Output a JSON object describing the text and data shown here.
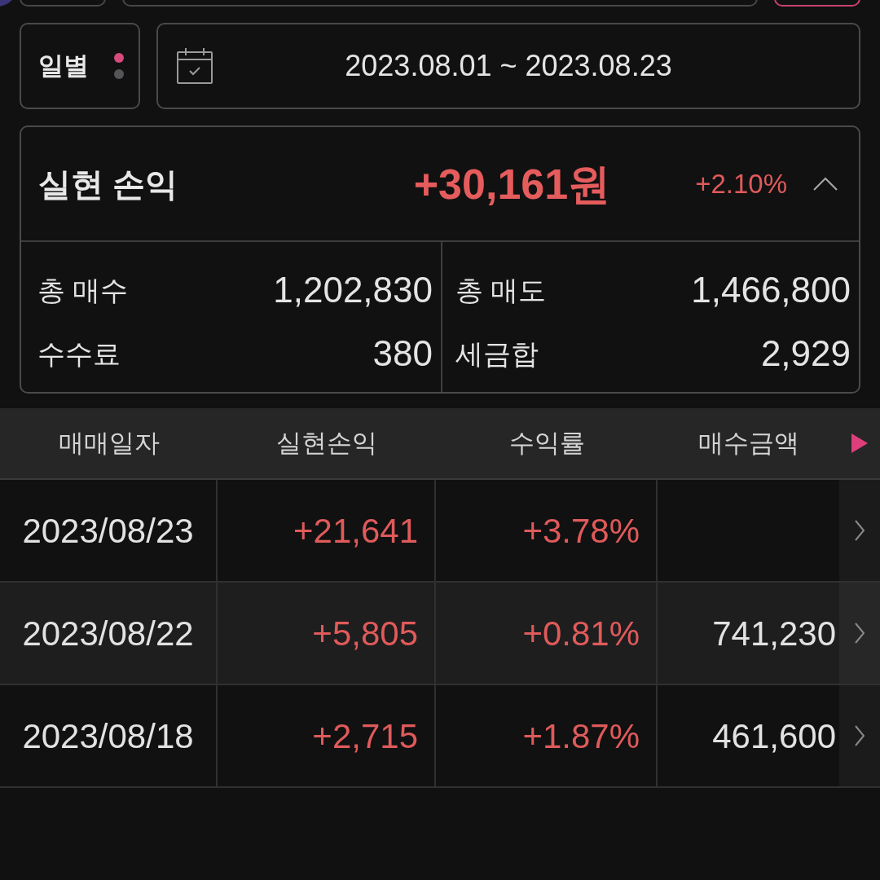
{
  "period": {
    "label": "일별",
    "dots": [
      {
        "selected": true
      },
      {
        "selected": false
      }
    ]
  },
  "date_range": "2023.08.01 ~ 2023.08.23",
  "summary": {
    "title": "실현 손익",
    "amount": "+30,161원",
    "rate": "+2.10%",
    "expanded": true,
    "items": [
      {
        "label": "총 매수",
        "value": "1,202,830"
      },
      {
        "label": "총 매도",
        "value": "1,466,800"
      },
      {
        "label": "수수료",
        "value": "380"
      },
      {
        "label": "세금합",
        "value": "2,929"
      }
    ]
  },
  "table": {
    "columns": [
      "매매일자",
      "실현손익",
      "수익률",
      "매수금액"
    ],
    "rows": [
      {
        "date": "2023/08/23",
        "profit": "+21,641",
        "rate": "+3.78%"
      },
      {
        "date": "2023/08/22",
        "profit": "+5,805",
        "rate": "+0.81%",
        "amount": "741,230"
      },
      {
        "date": "2023/08/18",
        "profit": "+2,715",
        "rate": "+1.87%",
        "amount": "461,600"
      }
    ]
  }
}
